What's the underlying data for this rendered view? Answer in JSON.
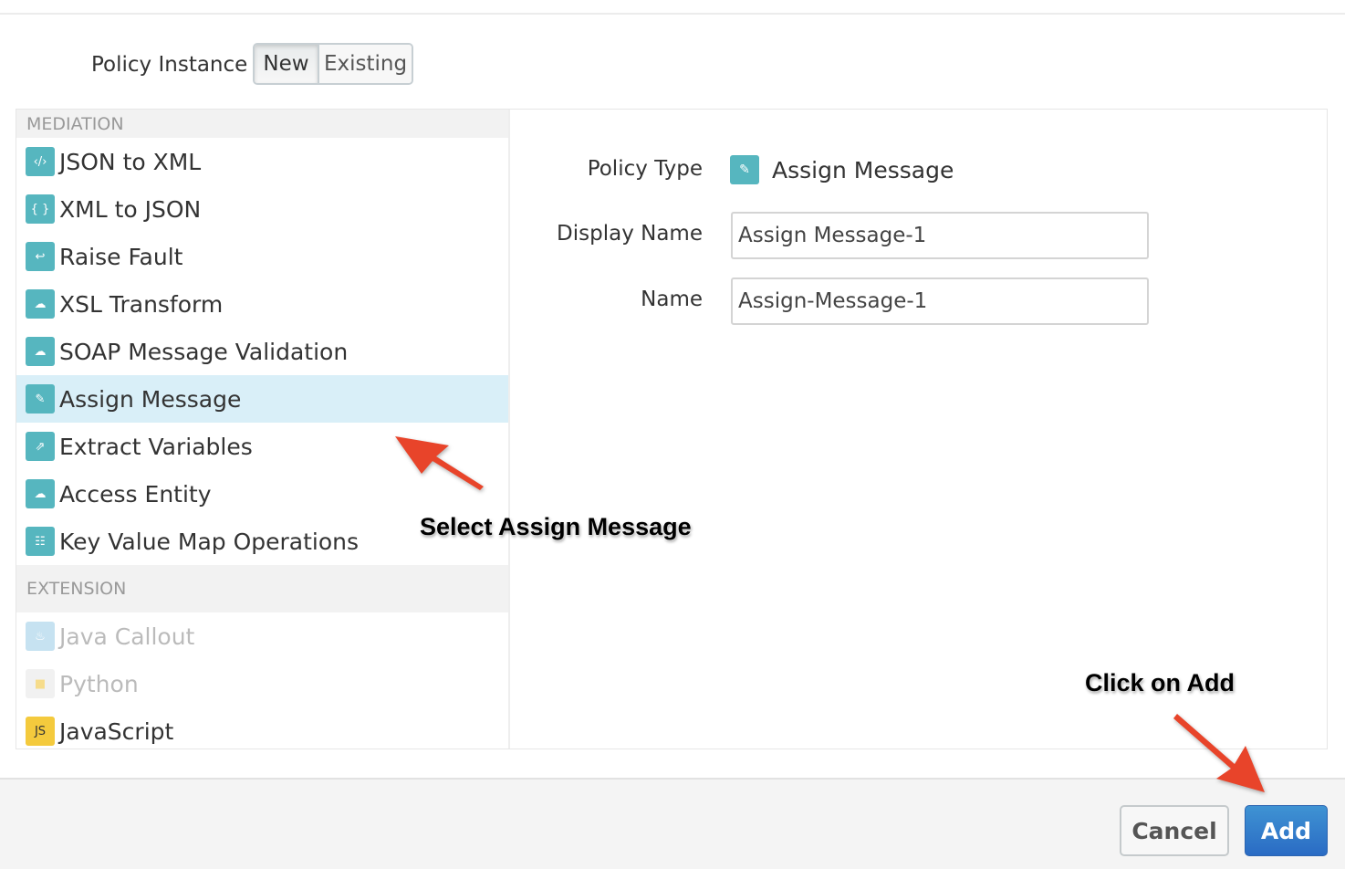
{
  "policy_instance": {
    "label": "Policy Instance",
    "options": [
      "New",
      "Existing"
    ],
    "selected": "New"
  },
  "categories": {
    "mediation": "MEDIATION",
    "extension": "EXTENSION"
  },
  "mediation_items": [
    {
      "label": "JSON to XML",
      "icon": "json-to-xml-icon",
      "glyph": "‹/›"
    },
    {
      "label": "XML to JSON",
      "icon": "xml-to-json-icon",
      "glyph": "{ }"
    },
    {
      "label": "Raise Fault",
      "icon": "raise-fault-icon",
      "glyph": "↩"
    },
    {
      "label": "XSL Transform",
      "icon": "cloud-check-icon",
      "glyph": "☁"
    },
    {
      "label": "SOAP Message Validation",
      "icon": "cloud-check-icon",
      "glyph": "☁"
    },
    {
      "label": "Assign Message",
      "icon": "edit-icon",
      "glyph": "✎",
      "selected": true
    },
    {
      "label": "Extract Variables",
      "icon": "extract-icon",
      "glyph": "⇗"
    },
    {
      "label": "Access Entity",
      "icon": "cloud-check-icon",
      "glyph": "☁"
    },
    {
      "label": "Key Value Map Operations",
      "icon": "key-value-map-icon",
      "glyph": "☷"
    }
  ],
  "extension_items": [
    {
      "label": "Java Callout",
      "icon": "java-icon",
      "glyph": "♨",
      "disabled": true
    },
    {
      "label": "Python",
      "icon": "python-icon",
      "glyph": "■",
      "disabled": true
    },
    {
      "label": "JavaScript",
      "icon": "javascript-icon",
      "glyph": "JS"
    }
  ],
  "form": {
    "policy_type_label": "Policy Type",
    "policy_type_value": "Assign Message",
    "display_name_label": "Display Name",
    "display_name_value": "Assign Message-1",
    "name_label": "Name",
    "name_value": "Assign-Message-1"
  },
  "annotations": {
    "select": "Select Assign Message",
    "click": "Click on Add"
  },
  "buttons": {
    "cancel": "Cancel",
    "add": "Add"
  },
  "colors": {
    "accent": "#56b6bf",
    "selected_row": "#d9eff8",
    "primary": "#2f78c8",
    "arrow": "#e8442a"
  }
}
